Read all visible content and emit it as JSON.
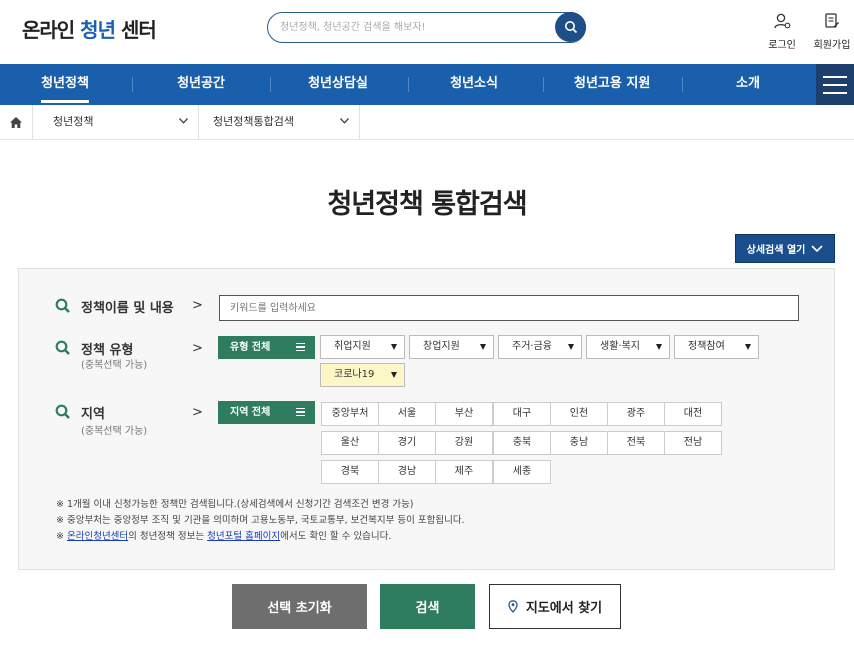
{
  "header": {
    "logo_prefix": "온라인 ",
    "logo_accent": "청년",
    "logo_suffix": " 센터",
    "search_placeholder": "청년정책, 청년공간 검색을 해보자!",
    "login_label": "로그인",
    "signup_label": "회원가입"
  },
  "nav": {
    "items": [
      {
        "label": "청년정책",
        "active": true
      },
      {
        "label": "청년공간"
      },
      {
        "label": "청년상담실"
      },
      {
        "label": "청년소식"
      },
      {
        "label": "청년고용 지원"
      },
      {
        "label": "소개"
      }
    ]
  },
  "breadcrumb": {
    "level1": "청년정책",
    "level2": "청년정책통합검색"
  },
  "page": {
    "title": "청년정책 통합검색",
    "detail_toggle": "상세검색 열기"
  },
  "form": {
    "name_label": "정책이름 및 내용",
    "keyword_placeholder": "키워드를 입력하세요",
    "type_label": "정책 유형",
    "type_sub": "(중복선택 가능)",
    "type_all": "유형 전체",
    "types": [
      "취업지원",
      "창업지원",
      "주거·금융",
      "생활·복지",
      "정책참여",
      "코로나19"
    ],
    "region_label": "지역",
    "region_sub": "(중복선택 가능)",
    "region_all": "지역 전체",
    "regions": [
      "중앙부처",
      "서울",
      "부산",
      "대구",
      "인천",
      "광주",
      "대전",
      "울산",
      "경기",
      "강원",
      "충북",
      "충남",
      "전북",
      "전남",
      "경북",
      "경남",
      "제주",
      "세종"
    ]
  },
  "notes": {
    "line1": "※ 1개월 이내 신청가능한 정책만 검색됩니다.(상세검색에서 신청기간 검색조건 변경 가능)",
    "line2": "※ 중앙부처는 중앙정부 조직 및 기관을 의미하며 고용노동부, 국토교통부, 보건복지부 등이 포함됩니다.",
    "line3_prefix": "※ ",
    "line3_link1": "온라인청년센터",
    "line3_mid": "의 청년정책 정보는 ",
    "line3_link2": "청년포털 홈페이지",
    "line3_suffix": "에서도 확인 할 수 있습니다."
  },
  "actions": {
    "reset": "선택 초기화",
    "search": "검색",
    "map": "지도에서 찾기"
  },
  "colors": {
    "nav_bg": "#1a5fac",
    "green": "#2e7d5e",
    "gray_button": "#6e6e6e",
    "highlight": "#fdf6c6"
  },
  "icons": [
    "search-icon",
    "user-icon",
    "signup-icon",
    "menu-icon",
    "home-icon",
    "chevron-down-icon",
    "map-pin-icon"
  ]
}
